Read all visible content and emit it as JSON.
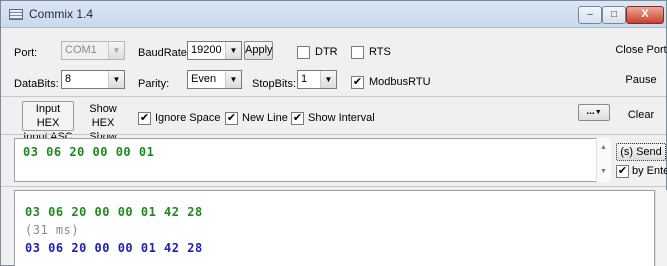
{
  "window": {
    "title": "Commix 1.4"
  },
  "controls": {
    "minimize": "–",
    "maximize": "□",
    "close": "X"
  },
  "row1": {
    "port_label": "Port:",
    "port_value": "COM1",
    "baud_label": "BaudRate:",
    "baud_value": "19200",
    "apply": "Apply",
    "dtr": "DTR",
    "rts": "RTS",
    "close_port": "Close Port"
  },
  "row2": {
    "databits_label": "DataBits:",
    "databits_value": "8",
    "parity_label": "Parity:",
    "parity_value": "Even",
    "stopbits_label": "StopBits:",
    "stopbits_value": "1",
    "modbus": "ModbusRTU",
    "pause": "Pause"
  },
  "row3": {
    "input_hex": "Input HEX",
    "input_asc": "Input ASC",
    "show_hex": "Show HEX",
    "show_asc": "Show ASC",
    "ignore_space": "Ignore Space",
    "new_line": "New Line",
    "show_interval": "Show Interval",
    "more": "...",
    "clear": "Clear"
  },
  "send": {
    "input_text": "03 06 20 00 00 01",
    "send_label": "(s) Send",
    "by_enter": "by Enter"
  },
  "output": {
    "lines": [
      {
        "text": "03 06 20 00 00 01 42 28",
        "color": "#1e8a1e"
      },
      {
        "text": "(31 ms)",
        "color": "#8a8a8a"
      },
      {
        "text": "03 06 20 00 00 01 42 28",
        "color": "#2020b4"
      }
    ]
  },
  "checks": {
    "mark": "✔",
    "dropdown": "▼",
    "up": "▲",
    "down": "▼"
  }
}
